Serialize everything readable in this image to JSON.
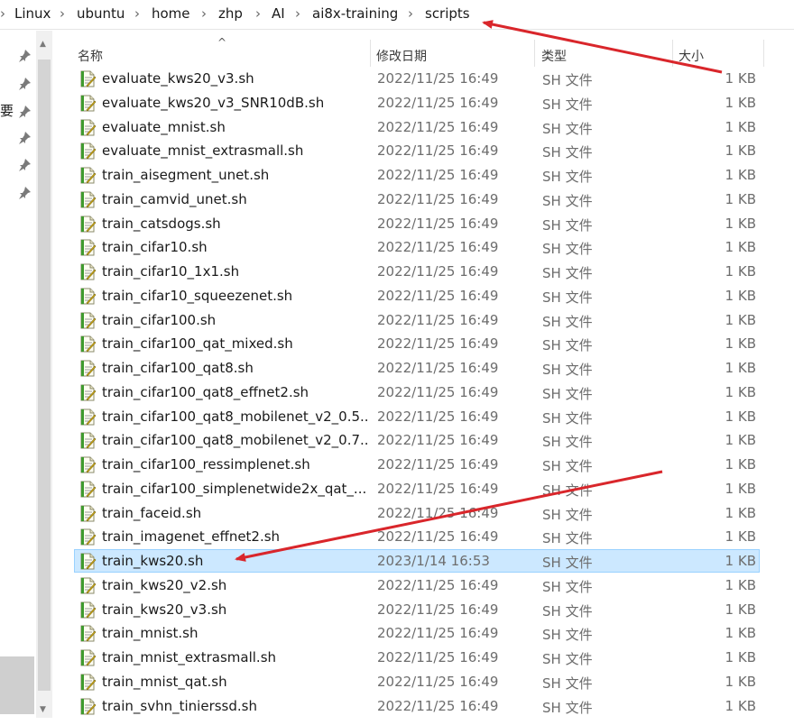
{
  "breadcrumb": {
    "items": [
      "Linux",
      "ubuntu",
      "home",
      "zhp",
      "AI",
      "ai8x-training",
      "scripts"
    ],
    "separator": "›"
  },
  "nav": {
    "truncated_label": "要",
    "pin_icon": "pin-icon"
  },
  "columns": {
    "name": "名称",
    "date": "修改日期",
    "type": "类型",
    "size": "大小"
  },
  "files": [
    {
      "name": "evaluate_kws20_v3.sh",
      "date": "2022/11/25 16:49",
      "type": "SH 文件",
      "size": "1 KB"
    },
    {
      "name": "evaluate_kws20_v3_SNR10dB.sh",
      "date": "2022/11/25 16:49",
      "type": "SH 文件",
      "size": "1 KB"
    },
    {
      "name": "evaluate_mnist.sh",
      "date": "2022/11/25 16:49",
      "type": "SH 文件",
      "size": "1 KB"
    },
    {
      "name": "evaluate_mnist_extrasmall.sh",
      "date": "2022/11/25 16:49",
      "type": "SH 文件",
      "size": "1 KB"
    },
    {
      "name": "train_aisegment_unet.sh",
      "date": "2022/11/25 16:49",
      "type": "SH 文件",
      "size": "1 KB"
    },
    {
      "name": "train_camvid_unet.sh",
      "date": "2022/11/25 16:49",
      "type": "SH 文件",
      "size": "1 KB"
    },
    {
      "name": "train_catsdogs.sh",
      "date": "2022/11/25 16:49",
      "type": "SH 文件",
      "size": "1 KB"
    },
    {
      "name": "train_cifar10.sh",
      "date": "2022/11/25 16:49",
      "type": "SH 文件",
      "size": "1 KB"
    },
    {
      "name": "train_cifar10_1x1.sh",
      "date": "2022/11/25 16:49",
      "type": "SH 文件",
      "size": "1 KB"
    },
    {
      "name": "train_cifar10_squeezenet.sh",
      "date": "2022/11/25 16:49",
      "type": "SH 文件",
      "size": "1 KB"
    },
    {
      "name": "train_cifar100.sh",
      "date": "2022/11/25 16:49",
      "type": "SH 文件",
      "size": "1 KB"
    },
    {
      "name": "train_cifar100_qat_mixed.sh",
      "date": "2022/11/25 16:49",
      "type": "SH 文件",
      "size": "1 KB"
    },
    {
      "name": "train_cifar100_qat8.sh",
      "date": "2022/11/25 16:49",
      "type": "SH 文件",
      "size": "1 KB"
    },
    {
      "name": "train_cifar100_qat8_effnet2.sh",
      "date": "2022/11/25 16:49",
      "type": "SH 文件",
      "size": "1 KB"
    },
    {
      "name": "train_cifar100_qat8_mobilenet_v2_0.5....",
      "date": "2022/11/25 16:49",
      "type": "SH 文件",
      "size": "1 KB"
    },
    {
      "name": "train_cifar100_qat8_mobilenet_v2_0.7...",
      "date": "2022/11/25 16:49",
      "type": "SH 文件",
      "size": "1 KB"
    },
    {
      "name": "train_cifar100_ressimplenet.sh",
      "date": "2022/11/25 16:49",
      "type": "SH 文件",
      "size": "1 KB"
    },
    {
      "name": "train_cifar100_simplenetwide2x_qat_...",
      "date": "2022/11/25 16:49",
      "type": "SH 文件",
      "size": "1 KB"
    },
    {
      "name": "train_faceid.sh",
      "date": "2022/11/25 16:49",
      "type": "SH 文件",
      "size": "1 KB"
    },
    {
      "name": "train_imagenet_effnet2.sh",
      "date": "2022/11/25 16:49",
      "type": "SH 文件",
      "size": "1 KB"
    },
    {
      "name": "train_kws20.sh",
      "date": "2023/1/14 16:53",
      "type": "SH 文件",
      "size": "1 KB",
      "selected": true
    },
    {
      "name": "train_kws20_v2.sh",
      "date": "2022/11/25 16:49",
      "type": "SH 文件",
      "size": "1 KB"
    },
    {
      "name": "train_kws20_v3.sh",
      "date": "2022/11/25 16:49",
      "type": "SH 文件",
      "size": "1 KB"
    },
    {
      "name": "train_mnist.sh",
      "date": "2022/11/25 16:49",
      "type": "SH 文件",
      "size": "1 KB"
    },
    {
      "name": "train_mnist_extrasmall.sh",
      "date": "2022/11/25 16:49",
      "type": "SH 文件",
      "size": "1 KB"
    },
    {
      "name": "train_mnist_qat.sh",
      "date": "2022/11/25 16:49",
      "type": "SH 文件",
      "size": "1 KB"
    },
    {
      "name": "train_svhn_tinierssd.sh",
      "date": "2022/11/25 16:49",
      "type": "SH 文件",
      "size": "1 KB"
    }
  ],
  "colors": {
    "selection_fill": "#cce8ff",
    "selection_border": "#99d1ff",
    "annotation_arrow": "#d9262b"
  },
  "icons": {
    "file": "sh-script-file-icon",
    "sort": "sort-ascending-caret-icon"
  }
}
